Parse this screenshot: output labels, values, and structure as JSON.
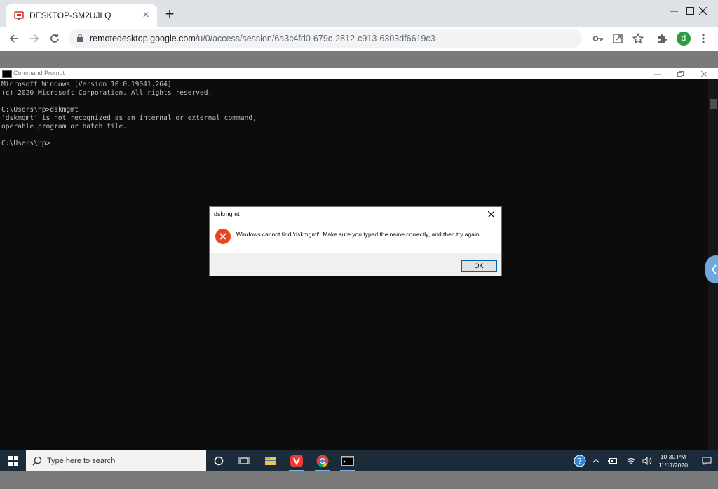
{
  "browser": {
    "tab_title": "DESKTOP-SM2UJLQ",
    "url_host": "remotedesktop.google.com",
    "url_path": "/u/0/access/session/6a3c4fd0-679c-2812-c913-6303df6619c3",
    "avatar_letter": "d",
    "avatar_color": "#2e9b3f"
  },
  "cmd": {
    "title": "Command Prompt",
    "lines": [
      "Microsoft Windows [Version 10.0.19041.264]",
      "(c) 2020 Microsoft Corporation. All rights reserved.",
      "",
      "C:\\Users\\hp>dskmgmt",
      "'dskmgmt' is not recognized as an internal or external command,",
      "operable program or batch file.",
      "",
      "C:\\Users\\hp>"
    ]
  },
  "dialog": {
    "title": "dskmgmt",
    "message": "Windows cannot find 'dskmgmt'. Make sure you typed the name correctly, and then try again.",
    "ok_label": "OK"
  },
  "taskbar": {
    "search_placeholder": "Type here to search",
    "time": "10:30 PM",
    "date": "11/17/2020"
  }
}
